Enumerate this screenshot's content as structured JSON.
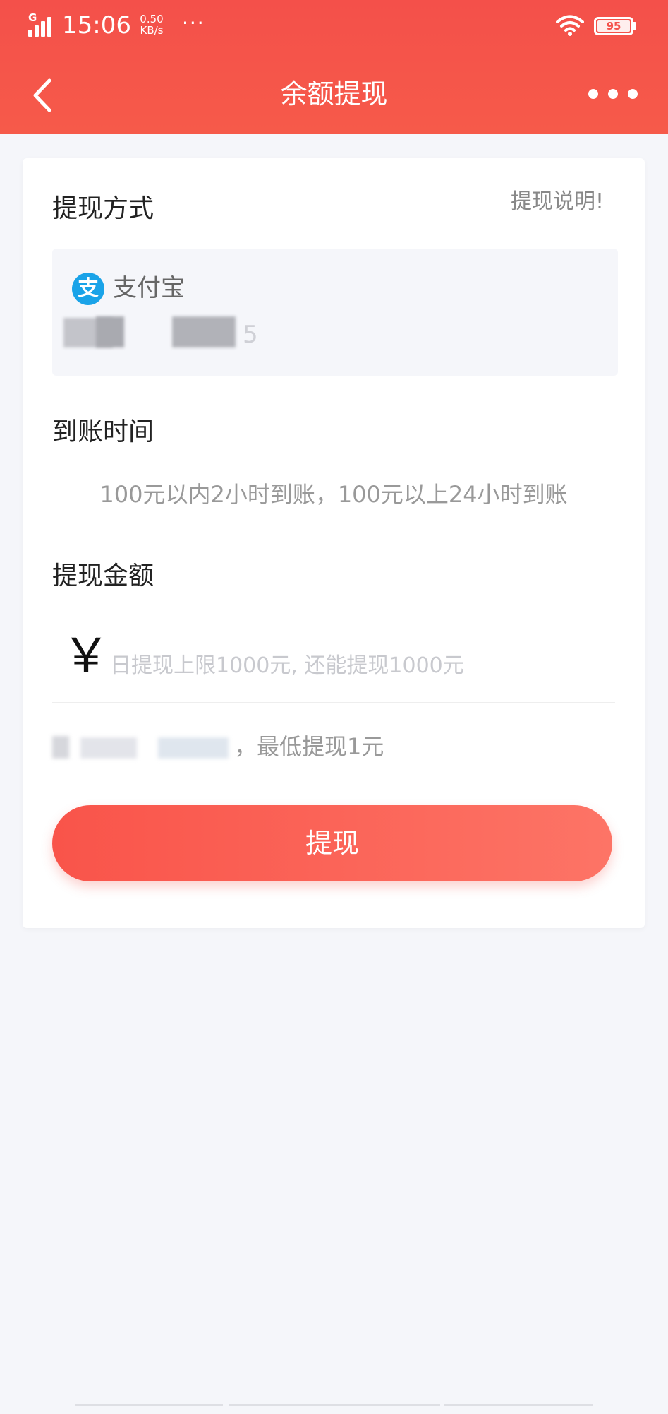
{
  "status_bar": {
    "network_type": "G",
    "time": "15:06",
    "speed_value": "0.50",
    "speed_unit": "KB/s",
    "more": "···",
    "battery": "95"
  },
  "nav": {
    "title": "余额提现"
  },
  "method": {
    "title": "提现方式",
    "help_link": "提现说明!",
    "provider": "支付宝",
    "provider_icon_glyph": "支",
    "account_tail": "5"
  },
  "arrival": {
    "title": "到账时间",
    "text": "100元以内2小时到账，100元以上24小时到账"
  },
  "amount": {
    "title": "提现金额",
    "currency_symbol": "￥",
    "placeholder": "日提现上限1000元, 还能提现1000元",
    "min_text": "，最低提现1元"
  },
  "submit": {
    "label": "提现"
  },
  "colors": {
    "header": "#f4504a",
    "button_start": "#f9544a",
    "button_end": "#fd7466",
    "alipay": "#1aa3e8",
    "page_bg": "#f5f6fa"
  },
  "icons": {
    "back": "back-arrow-icon",
    "more": "more-dots-icon",
    "wifi": "wifi-icon",
    "battery": "battery-icon",
    "signal": "signal-icon",
    "alipay": "alipay-icon",
    "currency": "yen-icon"
  }
}
